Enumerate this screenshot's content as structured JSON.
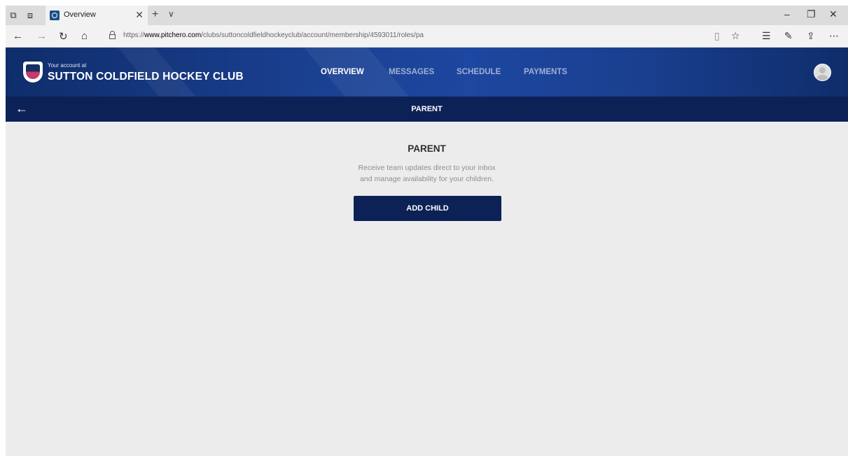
{
  "browser": {
    "tab_title": "Overview",
    "tab_close": "✕",
    "new_tab": "+",
    "tab_list": "∨",
    "url_prefix": "https://",
    "url_domain": "www.pitchero.com",
    "url_path": "/clubs/suttoncoldfieldhockeyclub/account/membership/4593011/roles/pa",
    "window_controls": {
      "minimize": "–",
      "restore": "❐",
      "close": "✕"
    },
    "nav_icons": {
      "back": "←",
      "forward": "→",
      "refresh": "↻",
      "home": "⌂"
    },
    "right_icons": {
      "reading": "▯",
      "favorite": "☆",
      "favorites_bar": "☰",
      "notes": "✎",
      "share": "⇪",
      "more": "⋯"
    }
  },
  "header": {
    "account_label": "Your account at",
    "club_name": "SUTTON COLDFIELD HOCKEY CLUB",
    "nav": [
      {
        "label": "OVERVIEW",
        "active": true
      },
      {
        "label": "MESSAGES",
        "active": false
      },
      {
        "label": "SCHEDULE",
        "active": false
      },
      {
        "label": "PAYMENTS",
        "active": false
      }
    ]
  },
  "subheader": {
    "back_icon": "←",
    "title": "PARENT"
  },
  "main": {
    "heading": "PARENT",
    "description_line1": "Receive team updates direct to your inbox",
    "description_line2": "and manage availability for your children.",
    "button_label": "ADD CHILD"
  },
  "colors": {
    "header_blue": "#1a3f8f",
    "subheader_navy": "#0c2257",
    "button_navy": "#0c2257",
    "background": "#ececec",
    "nav_active": "#ffffff",
    "nav_inactive": "#9fb0d6"
  }
}
